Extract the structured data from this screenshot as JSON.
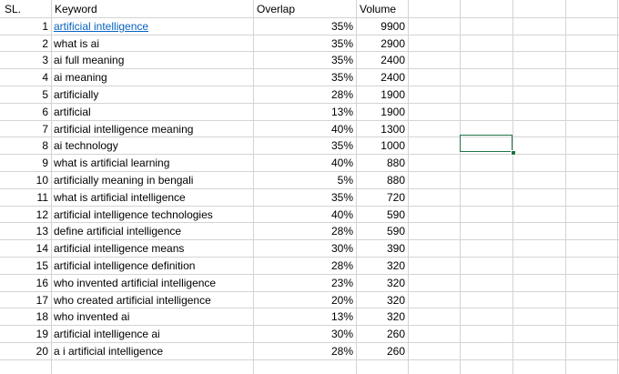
{
  "sheet": {
    "headers": {
      "sl": "SL.",
      "keyword": "Keyword",
      "overlap": "Overlap",
      "volume": "Volume"
    },
    "rows": [
      {
        "sl": "1",
        "keyword": "artificial intelligence",
        "overlap": "35%",
        "volume": "9900",
        "link": true
      },
      {
        "sl": "2",
        "keyword": "what is ai",
        "overlap": "35%",
        "volume": "2900"
      },
      {
        "sl": "3",
        "keyword": "ai full meaning",
        "overlap": "35%",
        "volume": "2400"
      },
      {
        "sl": "4",
        "keyword": "ai meaning",
        "overlap": "35%",
        "volume": "2400"
      },
      {
        "sl": "5",
        "keyword": "artificially",
        "overlap": "28%",
        "volume": "1900"
      },
      {
        "sl": "6",
        "keyword": "artificial",
        "overlap": "13%",
        "volume": "1900"
      },
      {
        "sl": "7",
        "keyword": "artificial intelligence meaning",
        "overlap": "40%",
        "volume": "1300"
      },
      {
        "sl": "8",
        "keyword": "ai technology",
        "overlap": "35%",
        "volume": "1000"
      },
      {
        "sl": "9",
        "keyword": "what is artificial learning",
        "overlap": "40%",
        "volume": "880"
      },
      {
        "sl": "10",
        "keyword": "artificially meaning in bengali",
        "overlap": "5%",
        "volume": "880"
      },
      {
        "sl": "11",
        "keyword": "what is artificial intelligence",
        "overlap": "35%",
        "volume": "720"
      },
      {
        "sl": "12",
        "keyword": "artificial intelligence technologies",
        "overlap": "40%",
        "volume": "590"
      },
      {
        "sl": "13",
        "keyword": "define artificial intelligence",
        "overlap": "28%",
        "volume": "590"
      },
      {
        "sl": "14",
        "keyword": "artificial intelligence means",
        "overlap": "30%",
        "volume": "390"
      },
      {
        "sl": "15",
        "keyword": "artificial intelligence definition",
        "overlap": "28%",
        "volume": "320"
      },
      {
        "sl": "16",
        "keyword": "who invented artificial intelligence",
        "overlap": "23%",
        "volume": "320"
      },
      {
        "sl": "17",
        "keyword": "who created artificial intelligence",
        "overlap": "20%",
        "volume": "320"
      },
      {
        "sl": "18",
        "keyword": "who invented ai",
        "overlap": "13%",
        "volume": "320"
      },
      {
        "sl": "19",
        "keyword": "artificial intelligence ai",
        "overlap": "30%",
        "volume": "260"
      },
      {
        "sl": "20",
        "keyword": "a i artificial intelligence",
        "overlap": "28%",
        "volume": "260"
      }
    ],
    "colors": {
      "gridline": "#d4d4d4",
      "selection": "#217346",
      "hyperlink": "#0563c1"
    }
  }
}
